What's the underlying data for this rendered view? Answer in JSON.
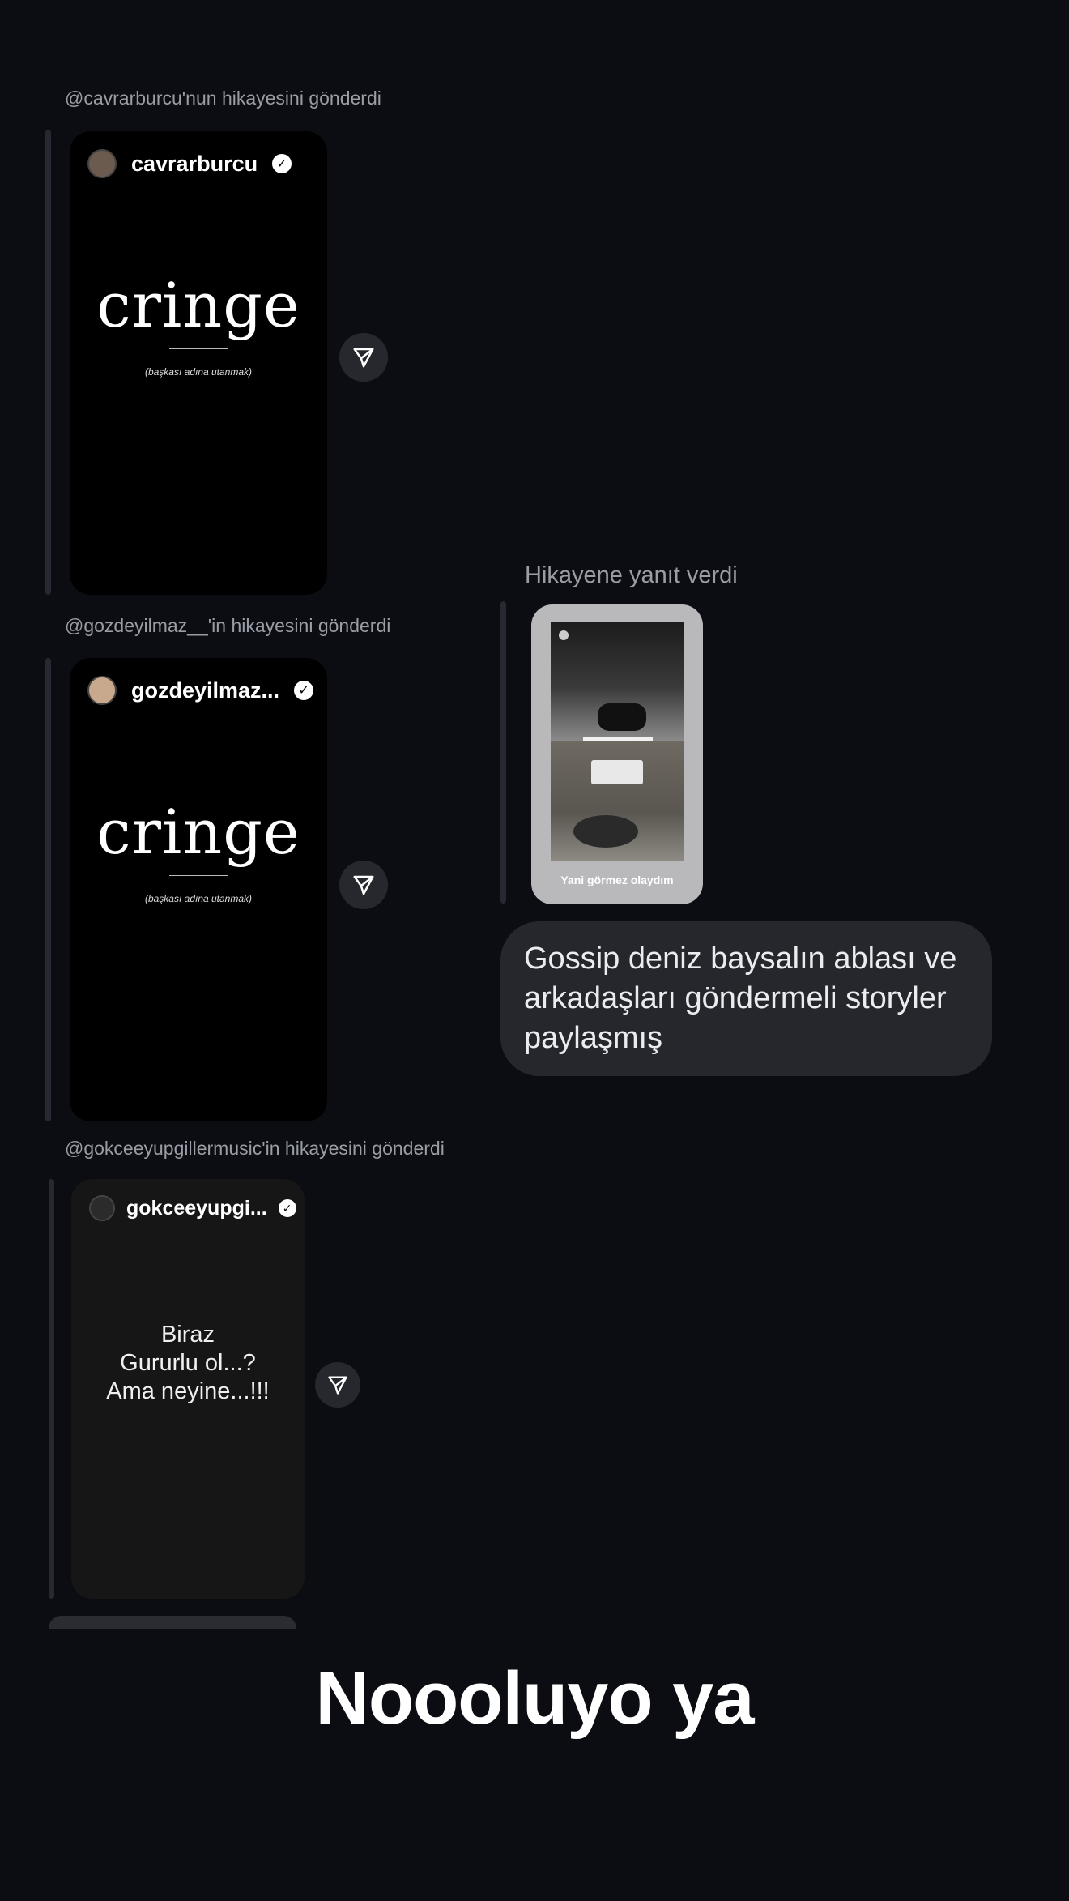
{
  "thread": {
    "shares": [
      {
        "label": "@cavrarburcu'nun hikayesini gönderdi",
        "username": "cavrarburcu",
        "verified_glyph": "✓",
        "story_word": "cringe",
        "story_sub": "(başkası adına utanmak)"
      },
      {
        "label": "@gozdeyilmaz__'in hikayesini gönderdi",
        "username": "gozdeyilmaz...",
        "verified_glyph": "✓",
        "story_word": "cringe",
        "story_sub": "(başkası adına utanmak)"
      },
      {
        "label": "@gokceeyupgillermusic'in hikayesini gönderdi",
        "username": "gokceeyupgi...",
        "verified_glyph": "✓",
        "story_text_lines": [
          "Biraz",
          "Gururlu ol...?",
          "Ama neyine...!!!"
        ]
      }
    ],
    "reply": {
      "label": "Hikayene yanıt verdi",
      "caption": "Yani görmez olaydım"
    },
    "message": {
      "lines": [
        "Gossip deniz baysalın ablası ve",
        "arkadaşları göndermeli storyler",
        "paylaşmış"
      ]
    }
  },
  "overlay_caption": "Noooluyo ya",
  "icons": {
    "send": "send-icon",
    "verified": "verified-badge-icon"
  },
  "colors": {
    "background": "#0b0d12",
    "bubble": "#25272d",
    "card": "#000000"
  }
}
